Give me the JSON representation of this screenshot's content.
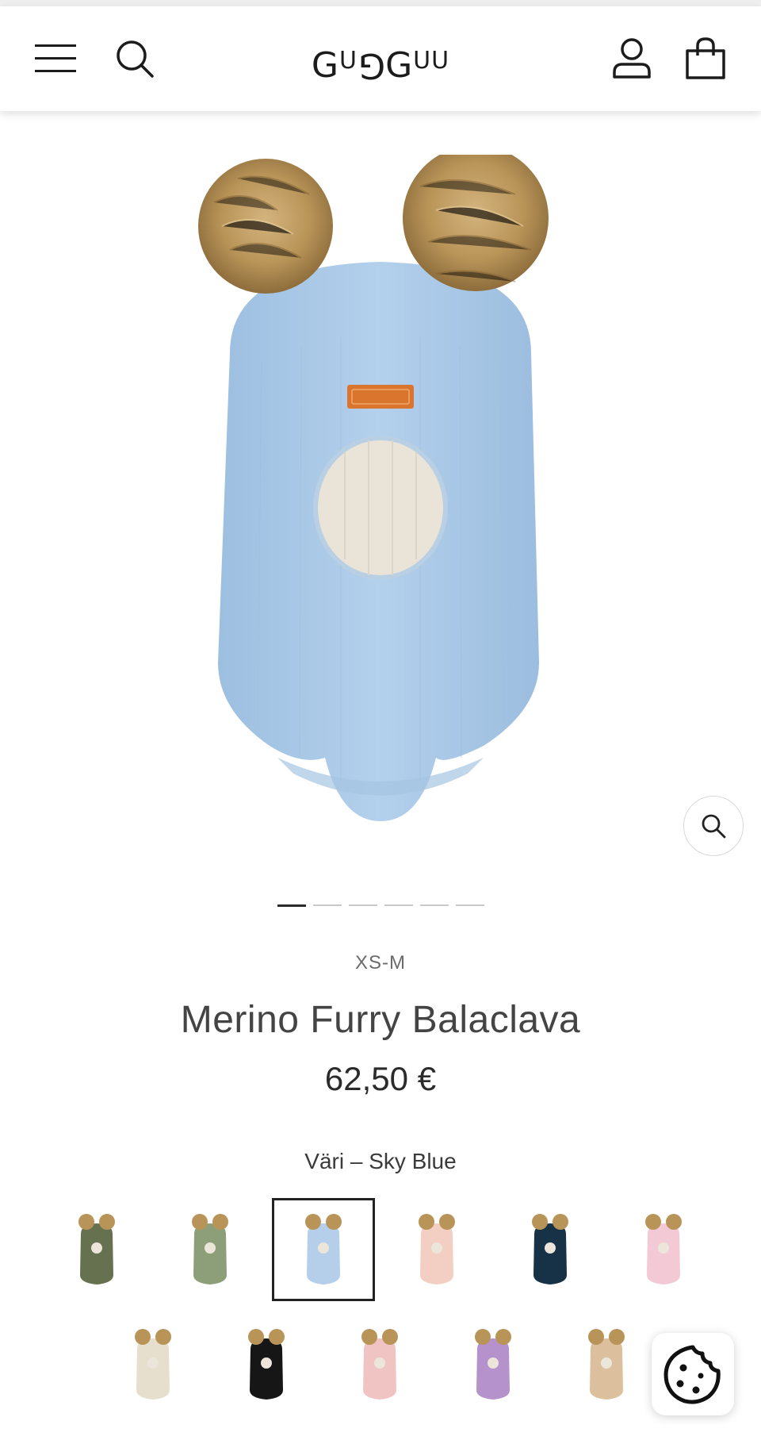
{
  "header": {
    "logo_main": "G",
    "logo_parts": [
      "G",
      "U",
      "G",
      "G",
      "U",
      "U"
    ],
    "menu_icon": "hamburger-icon",
    "search_icon": "search-icon",
    "account_icon": "user-icon",
    "cart_icon": "shopping-bag-icon"
  },
  "gallery": {
    "image_count": 6,
    "active_index": 0,
    "zoom_icon": "magnifier-icon"
  },
  "product": {
    "size_range": "XS-M",
    "title": "Merino Furry Balaclava",
    "price": "62,50 €",
    "color_label": "Väri – Sky Blue",
    "selected_color": "Sky Blue",
    "main_color": "#a9c9e6"
  },
  "swatches": [
    {
      "color": "#66714f",
      "selected": false
    },
    {
      "color": "#8d9f78",
      "selected": false
    },
    {
      "color": "#b5cfea",
      "selected": true
    },
    {
      "color": "#f2cfc2",
      "selected": false
    },
    {
      "color": "#173146",
      "selected": false
    },
    {
      "color": "#f4c9d6",
      "selected": false
    },
    {
      "color": "#e7dfcd",
      "selected": false
    },
    {
      "color": "#161616",
      "selected": false
    },
    {
      "color": "#f1c4c4",
      "selected": false
    },
    {
      "color": "#b592cc",
      "selected": false
    },
    {
      "color": "#dcc09e",
      "selected": false
    }
  ],
  "cookie": {
    "icon": "cookie-icon"
  }
}
